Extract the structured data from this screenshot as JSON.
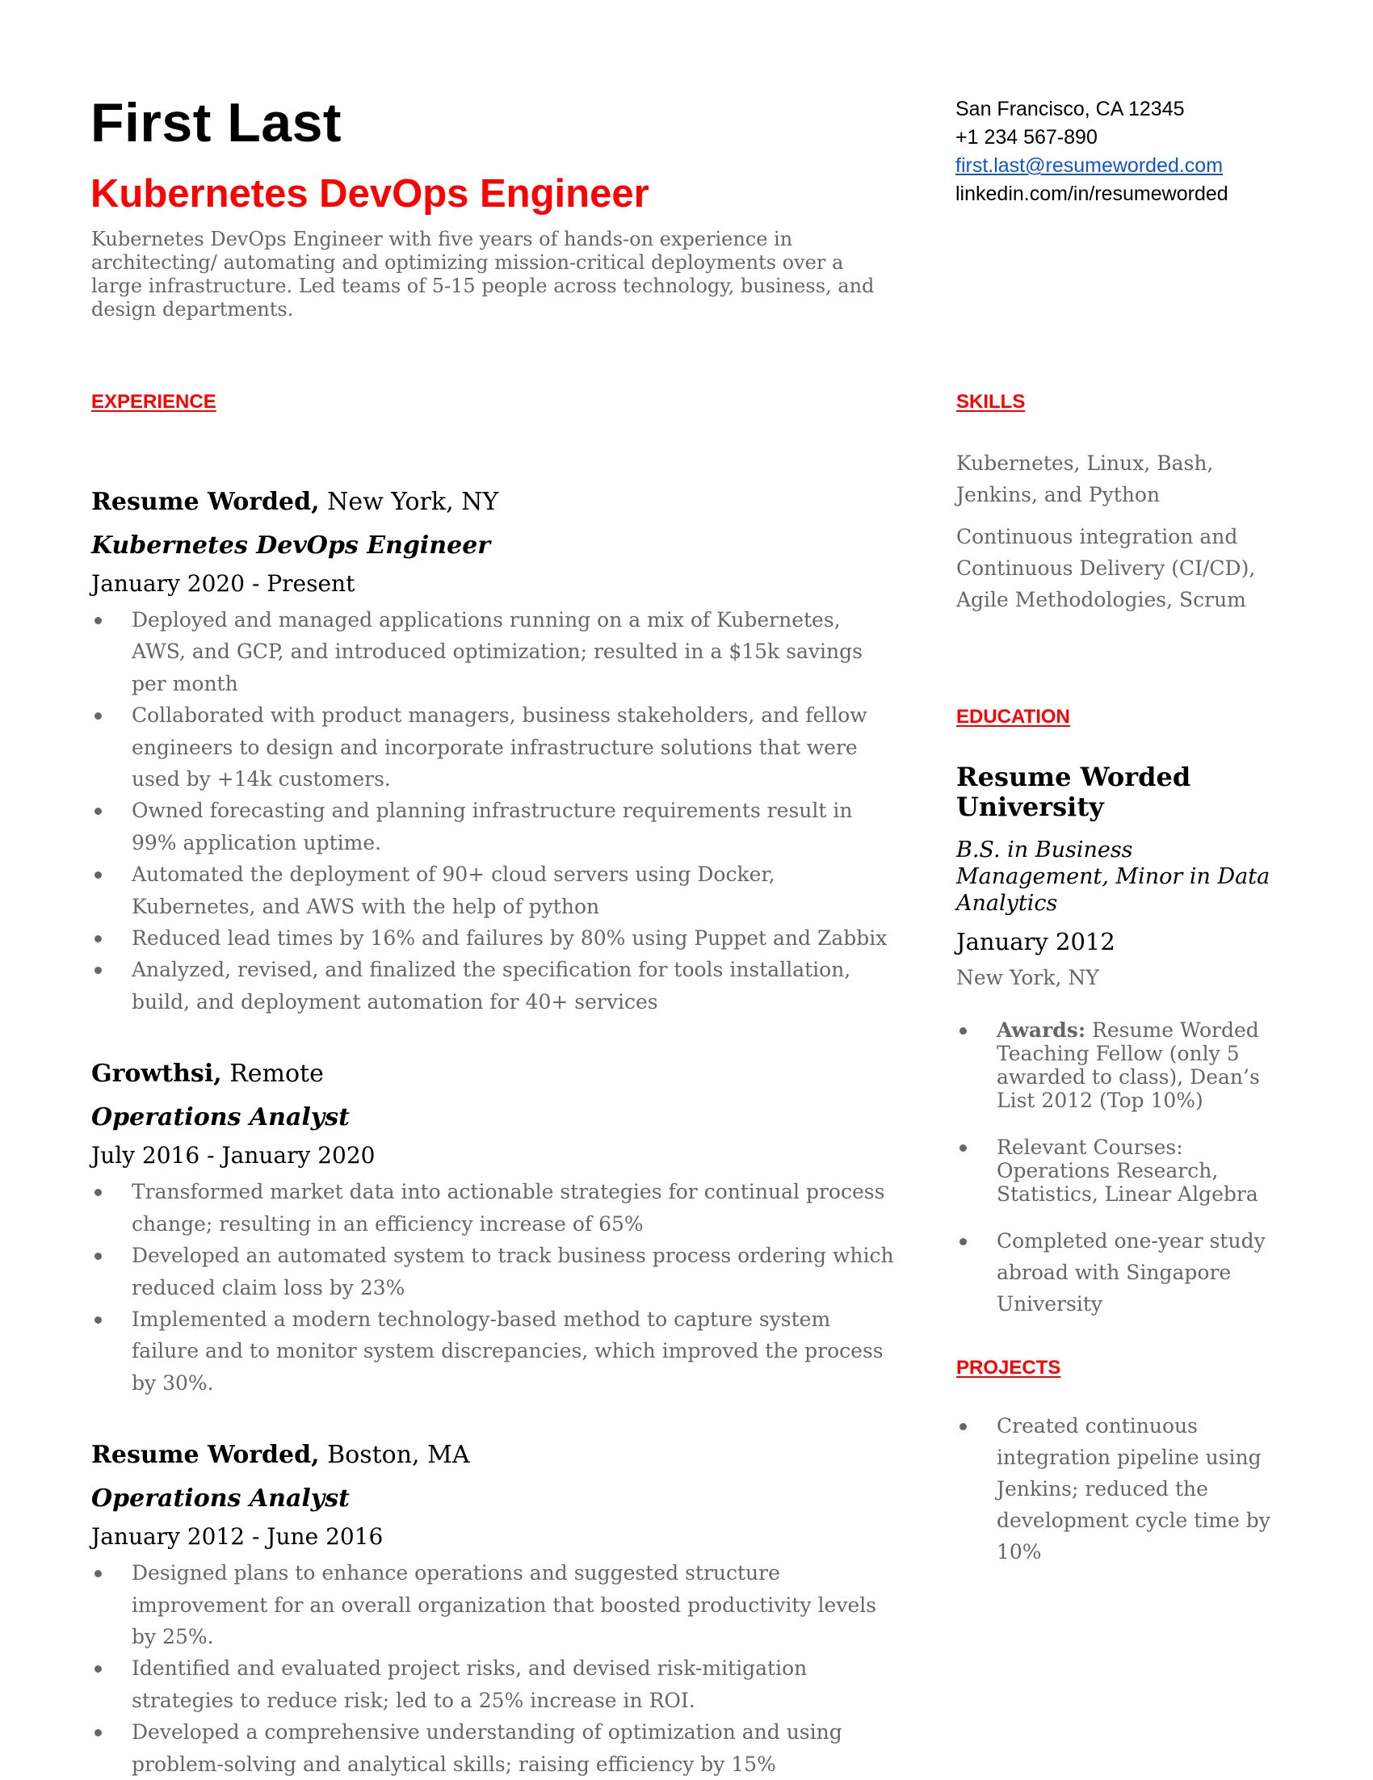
{
  "header": {
    "name": "First Last",
    "title": "Kubernetes DevOps Engineer",
    "summary": "Kubernetes DevOps Engineer with five years of hands-on experience in architecting/ automating and optimizing mission-critical deployments over a large infrastructure. Led teams of 5-15 people across technology, business, and design departments."
  },
  "contact": {
    "location": "San Francisco, CA 12345",
    "phone": "+1 234 567-890",
    "email": "first.last@resumeworded.com",
    "linkedin": "linkedin.com/in/resumeworded"
  },
  "colors": {
    "accent": "#ff0000",
    "link": "#1155cc",
    "body_text": "#666666"
  },
  "experience": {
    "heading": "EXPERIENCE",
    "jobs": [
      {
        "company": "Resume Worded,",
        "location": " New York, NY",
        "role": "Kubernetes DevOps Engineer",
        "dates": "January 2020 - Present",
        "bullets": [
          "Deployed and managed applications running on a mix of Kubernetes, AWS, and GCP, and introduced optimization; resulted in a $15k savings per month",
          "Collaborated with product managers, business stakeholders, and fellow engineers to design and incorporate infrastructure solutions that were used by +14k customers.",
          "Owned forecasting and planning infrastructure requirements result in 99% application uptime.",
          "Automated the deployment of 90+ cloud servers using Docker, Kubernetes, and AWS with the help of python",
          "Reduced lead times by 16% and failures by 80% using Puppet and Zabbix",
          "Analyzed, revised, and finalized the specification for tools installation, build, and deployment automation for 40+ services"
        ]
      },
      {
        "company": "Growthsi,",
        "location": " Remote",
        "role": "Operations Analyst",
        "dates": "July 2016 - January 2020",
        "bullets": [
          "Transformed market data into actionable strategies for continual process change; resulting in an efficiency increase of 65%",
          "Developed an automated  system to track business process ordering which reduced claim loss by 23%",
          "Implemented a modern technology-based method to capture system failure and to monitor system discrepancies, which improved the process by 30%."
        ]
      },
      {
        "company": "Resume Worded,",
        "location": " Boston, MA",
        "role": "Operations Analyst",
        "dates": "January 2012 - June 2016",
        "bullets": [
          "Designed plans to enhance operations and suggested structure improvement for an overall organization that boosted productivity levels by 25%.",
          "Identified and evaluated project risks, and devised risk-mitigation strategies to reduce risk; led to a 25% increase in ROI.",
          "Developed a comprehensive  understanding of optimization and using problem-solving and analytical skills; raising efficiency by 15%"
        ]
      }
    ]
  },
  "skills": {
    "heading": "SKILLS",
    "items": [
      "Kubernetes, Linux, Bash, Jenkins, and Python",
      "Continuous integration and Continuous Delivery (CI/CD), Agile Methodologies, Scrum"
    ]
  },
  "education": {
    "heading": "EDUCATION",
    "school": "Resume Worded University",
    "degree": "B.S. in Business Management, Minor in Data Analytics",
    "date": "January 2012",
    "location": "New York, NY",
    "bullets": [
      {
        "label": "Awards:",
        "text": " Resume Worded Teaching Fellow (only 5 awarded to class), Dean’s List 2012 (Top 10%)"
      },
      {
        "label": "",
        "text": "Relevant Courses: Operations Research, Statistics, Linear Algebra"
      },
      {
        "label": "",
        "text": "Completed one-year study abroad with Singapore University"
      }
    ]
  },
  "projects": {
    "heading": "PROJECTS",
    "bullets": [
      "Created continuous integration pipeline using Jenkins; reduced the development cycle time by 10%"
    ]
  }
}
